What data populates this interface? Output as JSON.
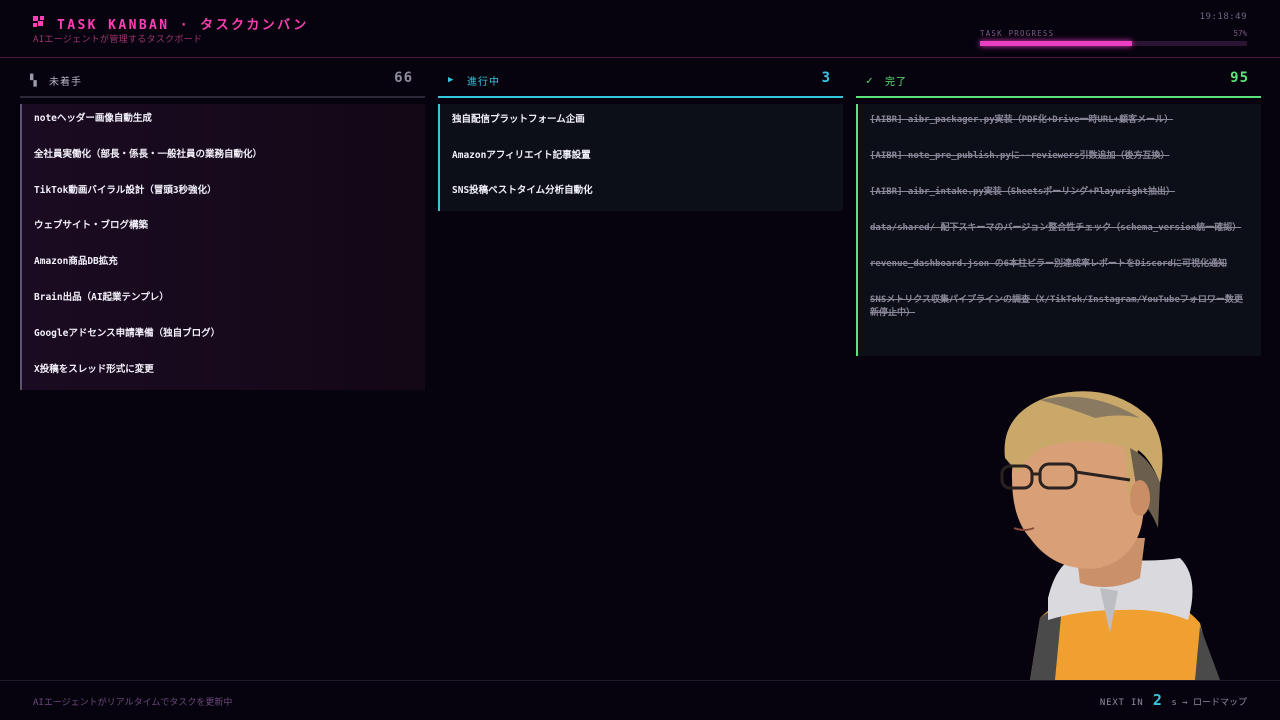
{
  "header": {
    "title": "TASK KANBAN · タスクカンバン",
    "subtitle": "AIエージェントが管理するタスクボード",
    "clock": "19:18:49",
    "progress_label": "TASK PROGRESS",
    "progress_value": "57%",
    "progress_fraction": 0.57,
    "accent_color": "#ff3fb4"
  },
  "columns": {
    "todo": {
      "icon": "grid-icon",
      "label": "未着手",
      "count": "66",
      "cards": [
        "noteヘッダー画像自動生成",
        "全社員実働化（部長・係長・一般社員の業務自動化）",
        "TikTok動画バイラル設計（冒頭3秒強化）",
        "ウェブサイト・ブログ構築",
        "Amazon商品DB拡充",
        "Brain出品（AI起業テンプレ）",
        "Googleアドセンス申請準備（独自ブログ）",
        "X投稿をスレッド形式に変更"
      ]
    },
    "doing": {
      "icon": "play-icon",
      "label": "進行中",
      "count": "3",
      "color": "#36c7e0",
      "cards": [
        "独自配信プラットフォーム企画",
        "Amazonアフィリエイト記事設置",
        "SNS投稿ベストタイム分析自動化"
      ]
    },
    "done": {
      "icon": "check-icon",
      "label": "完了",
      "count": "95",
      "color": "#5be37a",
      "cards": [
        "[AIBR] aibr_packager.py実装（PDF化+Drive一時URL+顧客メール）",
        "[AIBR] note_pre_publish.pyに--reviewers引数追加（後方互換）",
        "[AIBR] aibr_intake.py実装（Sheetsポーリング+Playwright抽出）",
        "data/shared/ 配下スキーマのバージョン整合性チェック（schema_version統一確認）",
        "revenue_dashboard.json の6本柱ピラー別達成率レポートをDiscordに可視化通知",
        "SNSメトリクス収集パイプラインの調査（X/TikTok/Instagram/YouTubeフォロワー数更新停止中）"
      ]
    }
  },
  "footer": {
    "status": "AIエージェントがリアルタイムでタスクを更新中",
    "next_label": "NEXT IN",
    "next_seconds": "2",
    "next_suffix": "s → ロードマップ"
  }
}
